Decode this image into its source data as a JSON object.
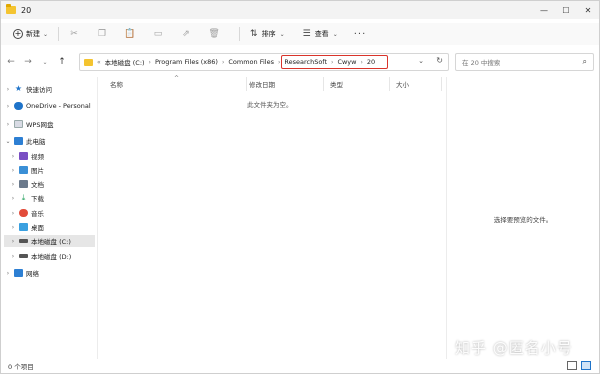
{
  "window": {
    "title": "20",
    "controls": {
      "minimize": "—",
      "maximize": "☐",
      "close": "✕"
    }
  },
  "toolbar": {
    "new_label": "新建",
    "sort_label": "排序",
    "view_label": "查看",
    "more_label": "···"
  },
  "address": {
    "segments": [
      "本地磁盘 (C:)",
      "Program Files (x86)",
      "Common Files",
      "ResearchSoft",
      "Cwyw",
      "20"
    ],
    "separator": "›",
    "overflow": "«"
  },
  "search": {
    "placeholder": "在 20 中搜索"
  },
  "sidebar": {
    "items": [
      {
        "label": "快速访问"
      },
      {
        "label": "OneDrive - Personal"
      },
      {
        "label": "WPS网盘"
      },
      {
        "label": "此电脑"
      },
      {
        "label": "视频"
      },
      {
        "label": "图片"
      },
      {
        "label": "文档"
      },
      {
        "label": "下载"
      },
      {
        "label": "音乐"
      },
      {
        "label": "桌面"
      },
      {
        "label": "本地磁盘 (C:)"
      },
      {
        "label": "本地磁盘 (D:)"
      },
      {
        "label": "网络"
      }
    ]
  },
  "columns": [
    "名称",
    "修改日期",
    "类型",
    "大小"
  ],
  "main": {
    "empty_message": "此文件夹为空。"
  },
  "preview": {
    "message": "选择要预览的文件。"
  },
  "status": {
    "item_count": "0 个项目"
  },
  "watermark": {
    "text": "知乎 @匿名小号"
  },
  "colors": {
    "highlight_border": "#d9342b",
    "folder": "#f4c430",
    "accent": "#1e73c9"
  }
}
